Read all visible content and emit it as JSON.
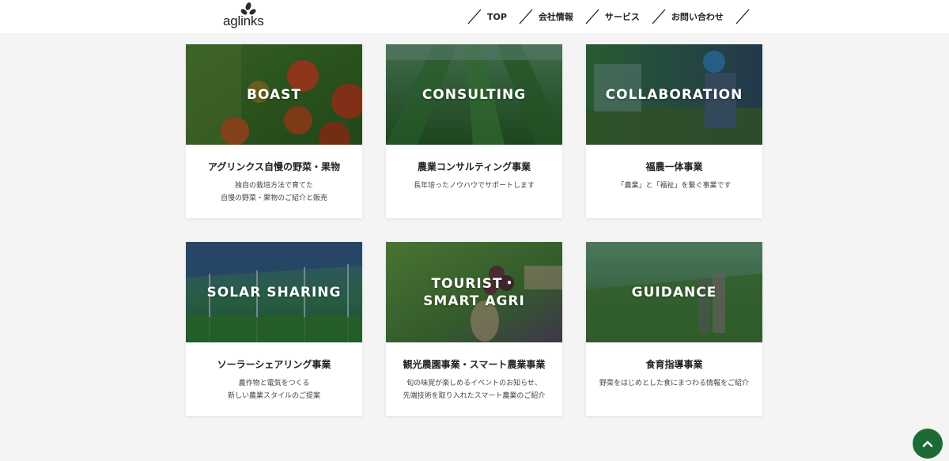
{
  "header": {
    "logo_text": "aglinks",
    "nav": [
      {
        "label": "TOP"
      },
      {
        "label": "会社情報"
      },
      {
        "label": "サービス"
      },
      {
        "label": "お問い合わせ"
      }
    ]
  },
  "colors": {
    "brand_green": "#1c6b34",
    "background": "#f4f4f4"
  },
  "services": [
    {
      "image_label": "BOAST",
      "title": "アグリンクス自慢の野菜・果物",
      "description": "独自の栽培方法で育てた\n自慢の野菜・果物のご紹介と販売"
    },
    {
      "image_label": "CONSULTING",
      "title": "農業コンサルティング事業",
      "description": "長年培ったノウハウでサポートします"
    },
    {
      "image_label": "COLLABORATION",
      "title": "福農一体事業",
      "description": "「農業」と「福祉」を繋ぐ事業です"
    },
    {
      "image_label": "SOLAR SHARING",
      "title": "ソーラーシェアリング事業",
      "description": "農作物と電気をつくる\n新しい農業スタイルのご提案"
    },
    {
      "image_label": "TOURIST・\nSMART AGRI",
      "title": "観光農園事業・スマート農業事業",
      "description": "旬の味覚が楽しめるイベントのお知らせ、\n先端技術を取り入れたスマート農業のご紹介"
    },
    {
      "image_label": "GUIDANCE",
      "title": "食育指導事業",
      "description": "野菜をはじめとした食にまつわる情報をご紹介"
    }
  ],
  "scroll_top": {
    "icon": "chevron-up-icon"
  }
}
